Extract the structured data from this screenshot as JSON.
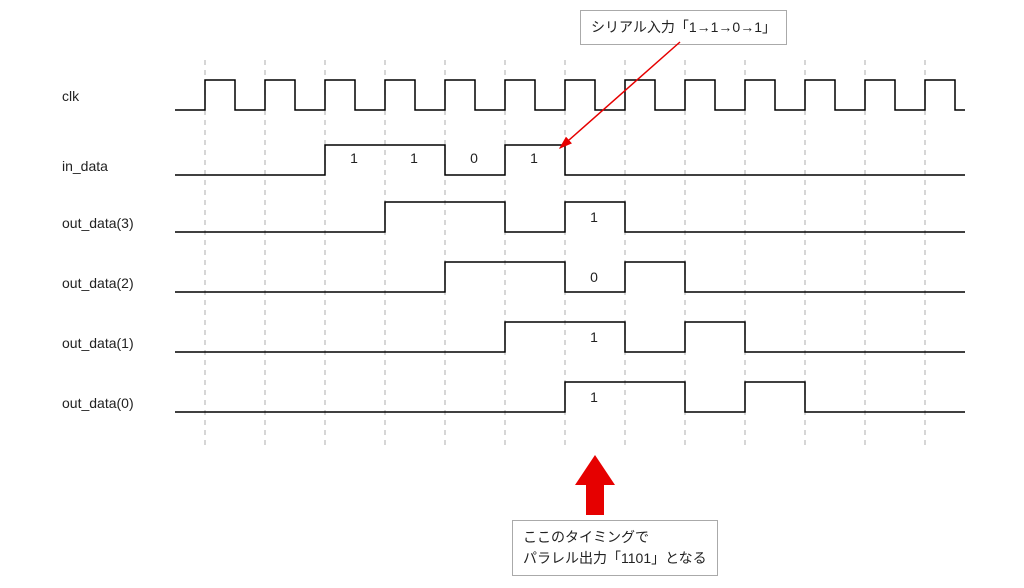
{
  "labels": {
    "clk": "clk",
    "in_data": "in_data",
    "out3": "out_data(3)",
    "out2": "out_data(2)",
    "out1": "out_data(1)",
    "out0": "out_data(0)"
  },
  "annot_top": "シリアル入力「1→1→0→1」",
  "annot_bottom_l1": "ここのタイミングで",
  "annot_bottom_l2": "パラレル出力「1101」となる",
  "bits": {
    "in": [
      "1",
      "1",
      "0",
      "1"
    ],
    "out3": "1",
    "out2": "0",
    "out1": "1",
    "out0": "1"
  },
  "chart_data": {
    "type": "timing-diagram",
    "title": "Serial-to-parallel shift register timing",
    "clock_periods_shown": 13,
    "grid_at_clock_edges": true,
    "signals": [
      {
        "name": "clk",
        "kind": "clock",
        "periods": 13,
        "duty_cycle": 0.5
      },
      {
        "name": "in_data",
        "kind": "data",
        "transitions": [
          {
            "t": 0,
            "level": 0
          },
          {
            "t": 2,
            "level": 1,
            "label": "1"
          },
          {
            "t": 3,
            "level": 1,
            "label": "1"
          },
          {
            "t": 4,
            "level": 0,
            "label": "0"
          },
          {
            "t": 5,
            "level": 1,
            "label": "1"
          },
          {
            "t": 6,
            "level": 0
          }
        ],
        "note": "t is in clock-period units from first rising edge"
      },
      {
        "name": "out_data(3)",
        "kind": "data",
        "transitions": [
          {
            "t": 0,
            "level": 0
          },
          {
            "t": 3,
            "level": 1
          },
          {
            "t": 5,
            "level": 0
          },
          {
            "t": 6,
            "level": 1,
            "label": "1"
          },
          {
            "t": 7,
            "level": 0
          }
        ]
      },
      {
        "name": "out_data(2)",
        "kind": "data",
        "transitions": [
          {
            "t": 0,
            "level": 0
          },
          {
            "t": 4,
            "level": 1
          },
          {
            "t": 6,
            "level": 0,
            "label": "0"
          },
          {
            "t": 7,
            "level": 1
          },
          {
            "t": 8,
            "level": 0
          }
        ]
      },
      {
        "name": "out_data(1)",
        "kind": "data",
        "transitions": [
          {
            "t": 0,
            "level": 0
          },
          {
            "t": 5,
            "level": 1
          },
          {
            "t": 7,
            "level": 0,
            "label_at": 6,
            "label": "1"
          },
          {
            "t": 8,
            "level": 1
          },
          {
            "t": 9,
            "level": 0
          }
        ]
      },
      {
        "name": "out_data(0)",
        "kind": "data",
        "transitions": [
          {
            "t": 0,
            "level": 0
          },
          {
            "t": 6,
            "level": 1,
            "label": "1"
          },
          {
            "t": 8,
            "level": 0
          },
          {
            "t": 9,
            "level": 1
          },
          {
            "t": 10,
            "level": 0
          }
        ]
      }
    ],
    "annotations": [
      {
        "kind": "callout",
        "text": "シリアル入力「1→1→0→1」",
        "points_to": {
          "signal": "in_data",
          "t": 5.8
        },
        "box_position": "top-right"
      },
      {
        "kind": "callout-arrow-up",
        "text": "ここのタイミングでパラレル出力「1101」となる",
        "points_to": {
          "t": 6.5
        },
        "box_position": "bottom-center"
      }
    ]
  }
}
